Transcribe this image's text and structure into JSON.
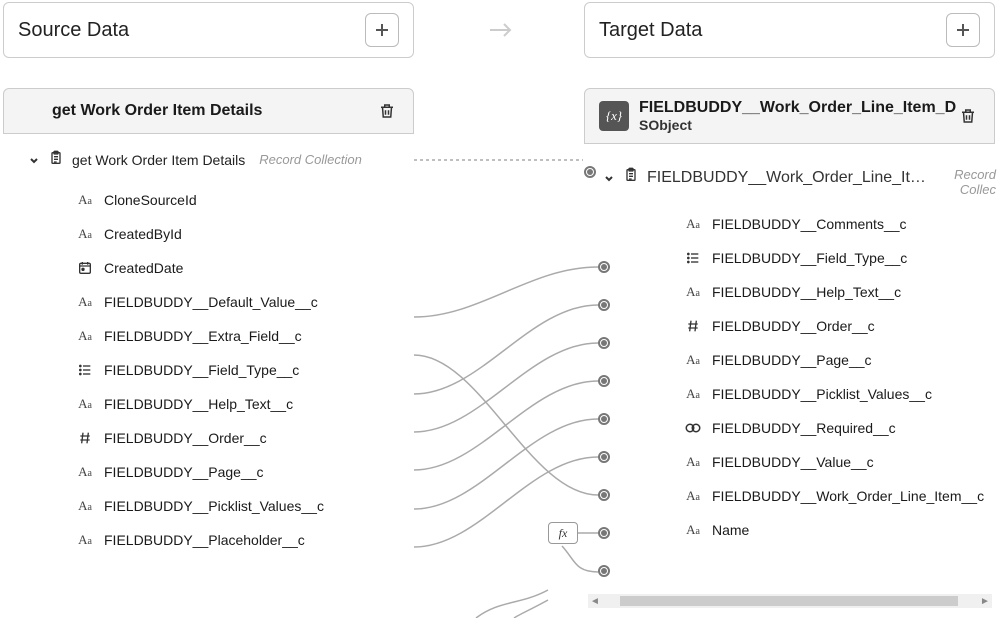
{
  "source": {
    "panel_title": "Source Data",
    "card_title": "get Work Order Item Details",
    "root_label": "get Work Order Item Details",
    "root_meta": "Record Collection",
    "fields": [
      {
        "icon": "Aa",
        "label": "CloneSourceId"
      },
      {
        "icon": "Aa",
        "label": "CreatedById"
      },
      {
        "icon": "date",
        "label": "CreatedDate"
      },
      {
        "icon": "Aa",
        "label": "FIELDBUDDY__Default_Value__c"
      },
      {
        "icon": "Aa",
        "label": "FIELDBUDDY__Extra_Field__c"
      },
      {
        "icon": "list",
        "label": "FIELDBUDDY__Field_Type__c"
      },
      {
        "icon": "Aa",
        "label": "FIELDBUDDY__Help_Text__c"
      },
      {
        "icon": "hash",
        "label": "FIELDBUDDY__Order__c"
      },
      {
        "icon": "Aa",
        "label": "FIELDBUDDY__Page__c"
      },
      {
        "icon": "Aa",
        "label": "FIELDBUDDY__Picklist_Values__c"
      },
      {
        "icon": "Aa",
        "label": "FIELDBUDDY__Placeholder__c"
      }
    ]
  },
  "target": {
    "panel_title": "Target Data",
    "card_title": "FIELDBUDDY__Work_Order_Line_Item_De...",
    "card_sub": "SObject",
    "root_label": "FIELDBUDDY__Work_Order_Line_Item_Detail__c",
    "root_meta": "Record Collection",
    "var_icon": "{x}",
    "fields": [
      {
        "icon": "Aa",
        "label": "FIELDBUDDY__Comments__c"
      },
      {
        "icon": "list",
        "label": "FIELDBUDDY__Field_Type__c"
      },
      {
        "icon": "Aa",
        "label": "FIELDBUDDY__Help_Text__c"
      },
      {
        "icon": "hash",
        "label": "FIELDBUDDY__Order__c"
      },
      {
        "icon": "Aa",
        "label": "FIELDBUDDY__Page__c"
      },
      {
        "icon": "Aa",
        "label": "FIELDBUDDY__Picklist_Values__c"
      },
      {
        "icon": "link",
        "label": "FIELDBUDDY__Required__c"
      },
      {
        "icon": "Aa",
        "label": "FIELDBUDDY__Value__c"
      },
      {
        "icon": "Aa",
        "label": "FIELDBUDDY__Work_Order_Line_Item__c"
      },
      {
        "icon": "Aa",
        "label": "Name"
      }
    ]
  },
  "fx_label": "fx"
}
